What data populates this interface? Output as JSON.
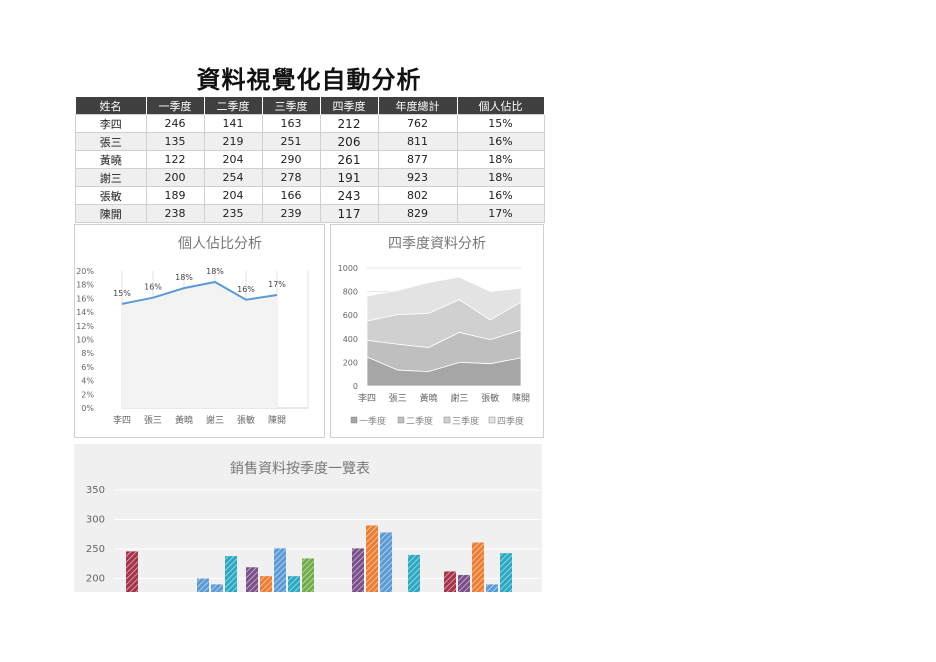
{
  "title": "資料視覺化自動分析",
  "table": {
    "headers": [
      "姓名",
      "一季度",
      "二季度",
      "三季度",
      "四季度",
      "年度總計",
      "個人佔比"
    ],
    "rows": [
      [
        "李四",
        "246",
        "141",
        "163",
        "212",
        "762",
        "15%"
      ],
      [
        "張三",
        "135",
        "219",
        "251",
        "206",
        "811",
        "16%"
      ],
      [
        "黃曉",
        "122",
        "204",
        "290",
        "261",
        "877",
        "18%"
      ],
      [
        "謝三",
        "200",
        "254",
        "278",
        "191",
        "923",
        "18%"
      ],
      [
        "張敏",
        "189",
        "204",
        "166",
        "243",
        "802",
        "16%"
      ],
      [
        "陳開",
        "238",
        "235",
        "239",
        "117",
        "829",
        "17%"
      ]
    ]
  },
  "chart_data": [
    {
      "type": "line",
      "title": "個人佔比分析",
      "categories": [
        "李四",
        "張三",
        "黃曉",
        "謝三",
        "張敏",
        "陳開"
      ],
      "values": [
        15.2,
        16.1,
        17.5,
        18.4,
        15.8,
        16.5
      ],
      "data_labels": [
        "15%",
        "16%",
        "18%",
        "18%",
        "16%",
        "17%"
      ],
      "yticks": [
        "0%",
        "2%",
        "4%",
        "6%",
        "8%",
        "10%",
        "12%",
        "14%",
        "16%",
        "18%",
        "20%"
      ],
      "ylim": [
        0,
        20
      ],
      "color": "#5b9bd5",
      "grid": "vertical"
    },
    {
      "type": "area",
      "stacked": true,
      "title": "四季度資料分析",
      "categories": [
        "李四",
        "張三",
        "黃曉",
        "謝三",
        "張敏",
        "陳開"
      ],
      "series": [
        {
          "name": "一季度",
          "values": [
            246,
            135,
            122,
            200,
            189,
            238
          ],
          "color": "#a6a6a6"
        },
        {
          "name": "二季度",
          "values": [
            141,
            219,
            204,
            254,
            204,
            235
          ],
          "color": "#bfbfbf"
        },
        {
          "name": "三季度",
          "values": [
            163,
            251,
            290,
            278,
            166,
            239
          ],
          "color": "#d0d0d0"
        },
        {
          "name": "四季度",
          "values": [
            212,
            206,
            261,
            191,
            243,
            117
          ],
          "color": "#e3e3e3"
        }
      ],
      "yticks": [
        "0",
        "200",
        "400",
        "600",
        "800",
        "1000"
      ],
      "ylim": [
        0,
        1000
      ],
      "legend": "bottom"
    },
    {
      "type": "bar",
      "title": "銷售資料按季度一覽表",
      "yticks": [
        "200",
        "250",
        "300",
        "350"
      ],
      "ylim": [
        150,
        360
      ],
      "groups": [
        {
          "values": [
            246,
            null,
            null,
            null,
            null,
            null
          ],
          "colors": [
            "#a5344a"
          ]
        },
        {
          "values": [
            null,
            null,
            200,
            190,
            238,
            null
          ],
          "colors": [
            "#5b9bd5",
            "#5b9bd5",
            "#2aa8c4",
            "#70ad47"
          ]
        },
        {
          "values": [
            219,
            204,
            251,
            204,
            234,
            null
          ],
          "colors": [
            "#7a4f8a",
            "#ed7d31",
            "#5b9bd5",
            "#2aa8c4",
            "#70ad47"
          ]
        },
        {
          "values": [
            251,
            290,
            278,
            null,
            240,
            null
          ],
          "colors": [
            "#7a4f8a",
            "#ed7d31",
            "#5b9bd5",
            "#2aa8c4",
            "#70ad47"
          ]
        },
        {
          "values": [
            212,
            206,
            261,
            190,
            243,
            null
          ],
          "colors": [
            "#a5344a",
            "#7a4f8a",
            "#ed7d31",
            "#5b9bd5",
            "#2aa8c4"
          ]
        }
      ]
    }
  ]
}
